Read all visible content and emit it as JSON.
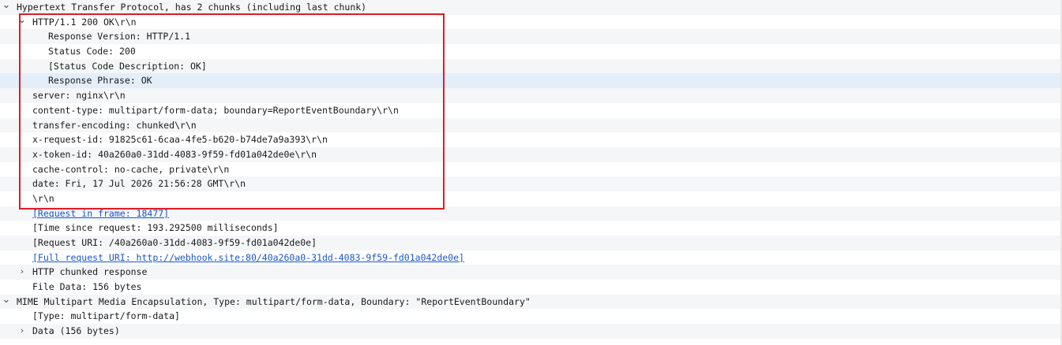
{
  "tree": [
    {
      "text": "Hypertext Transfer Protocol, has 2 chunks (including last chunk)",
      "level": 0,
      "toggle": "expanded"
    },
    {
      "text": "HTTP/1.1 200 OK\\r\\n",
      "level": 1,
      "toggle": "expanded"
    },
    {
      "text": "Response Version: HTTP/1.1",
      "level": 2
    },
    {
      "text": "Status Code: 200",
      "level": 2
    },
    {
      "text": "[Status Code Description: OK]",
      "level": 2
    },
    {
      "text": "Response Phrase: OK",
      "level": 2,
      "selected": true
    },
    {
      "text": "server: nginx\\r\\n",
      "level": 1
    },
    {
      "text": "content-type: multipart/form-data; boundary=ReportEventBoundary\\r\\n",
      "level": 1
    },
    {
      "text": "transfer-encoding: chunked\\r\\n",
      "level": 1
    },
    {
      "text": "x-request-id: 91825c61-6caa-4fe5-b620-b74de7a9a393\\r\\n",
      "level": 1
    },
    {
      "text": "x-token-id: 40a260a0-31dd-4083-9f59-fd01a042de0e\\r\\n",
      "level": 1
    },
    {
      "text": "cache-control: no-cache, private\\r\\n",
      "level": 1
    },
    {
      "text": "date: Fri, 17 Jul 2026 21:56:28 GMT\\r\\n",
      "level": 1
    },
    {
      "text": "\\r\\n",
      "level": 1
    },
    {
      "text": "[Request in frame: 18477]",
      "level": 1,
      "link": true
    },
    {
      "text": "[Time since request: 193.292500 milliseconds]",
      "level": 1
    },
    {
      "text": "[Request URI: /40a260a0-31dd-4083-9f59-fd01a042de0e]",
      "level": 1
    },
    {
      "text": "[Full request URI: http://webhook.site:80/40a260a0-31dd-4083-9f59-fd01a042de0e]",
      "level": 1,
      "link": true
    },
    {
      "text": "HTTP chunked response",
      "level": 1,
      "toggle": "collapsed"
    },
    {
      "text": "File Data: 156 bytes",
      "level": 1
    },
    {
      "text": "MIME Multipart Media Encapsulation, Type: multipart/form-data, Boundary: \"ReportEventBoundary\"",
      "level": 0,
      "toggle": "expanded"
    },
    {
      "text": "[Type: multipart/form-data]",
      "level": 1
    },
    {
      "text": "Data (156 bytes)",
      "level": 1,
      "toggle": "collapsed"
    }
  ],
  "icons": {
    "expanded": "expanded-chevron-icon",
    "collapsed": "collapsed-chevron-icon"
  },
  "colors": {
    "link": "#1a56c8",
    "selection": "#e3eef9",
    "alternate_row": "#f4f6f8",
    "highlight_box": "#e01b24"
  }
}
